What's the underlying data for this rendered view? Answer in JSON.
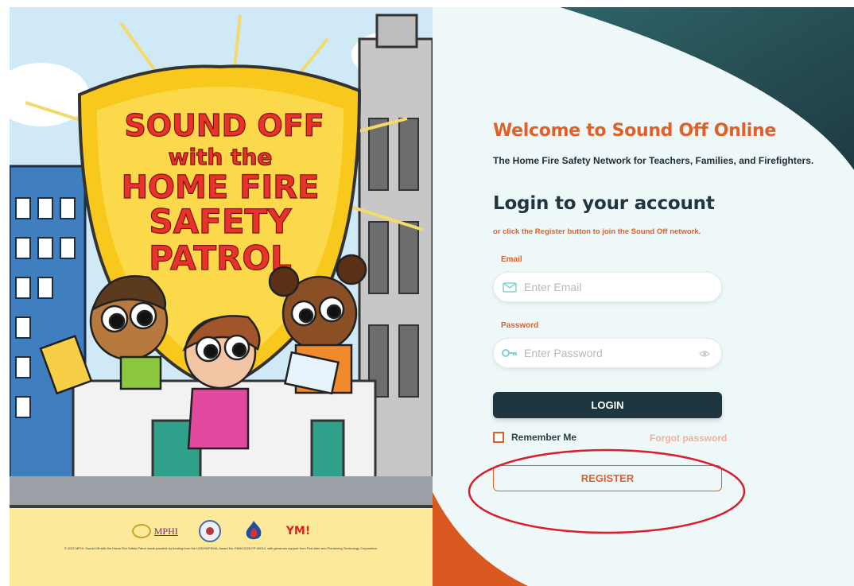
{
  "poster": {
    "title_lines": [
      "SOUND OFF",
      "with the",
      "HOME FIRE",
      "SAFETY",
      "PATROL"
    ],
    "logos": {
      "mphi": "MPHI",
      "fire_brand": "Fire is Everyone's Fight",
      "ym": "YM"
    },
    "footer_text": "© 2022 MPHI. Sound Off with the Home Fire Safety Patrol made possible by funding from the USDHS/FEMA, Award No. EMW-2020-FP-00010, with generous support from First Alert and Pioneering Technology Corporation."
  },
  "login": {
    "welcome": "Welcome to Sound Off Online",
    "tagline": "The Home Fire Safety Network for Teachers, Families, and Firefighters.",
    "heading": "Login to your account",
    "register_hint": "or click the Register button to join the Sound Off network.",
    "email": {
      "label": "Email",
      "placeholder": "Enter Email",
      "icon": "mail-icon"
    },
    "password": {
      "label": "Password",
      "placeholder": "Enter Password",
      "icon": "key-icon",
      "toggle_icon": "eye-icon"
    },
    "login_button": "LOGIN",
    "remember_me": "Remember Me",
    "forgot_password": "Forgot password",
    "register_button": "REGISTER"
  },
  "colors": {
    "accent": "#e0602a",
    "dark_teal": "#1e3640",
    "panel_bg": "#eef8f8",
    "annotation_red": "#d81e2a"
  }
}
